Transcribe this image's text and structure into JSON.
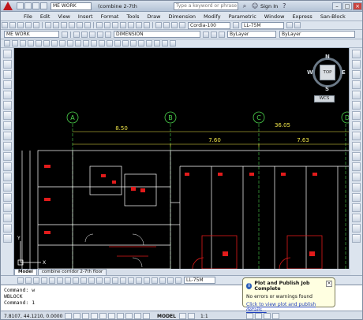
{
  "titlebar": {
    "workspace": "ME WORK",
    "title": "(combine 2-7th",
    "search_placeholder": "Type a keyword or phrase",
    "signin": "Sign In"
  },
  "menu": {
    "items": [
      "File",
      "Edit",
      "View",
      "Insert",
      "Format",
      "Tools",
      "Draw",
      "Dimension",
      "Modify",
      "Parametric",
      "Window",
      "Express",
      "San-Block"
    ]
  },
  "toolbar": {
    "text_style": "Cordia-100",
    "dim_style": "LL-75M",
    "workspace_combo": "ME WORK",
    "dimension_label": "DIMENSION",
    "layer_color": "ByLayer",
    "layer_lineweight": "ByLayer"
  },
  "viewcube": {
    "top": "TOP",
    "n": "N",
    "s": "S",
    "e": "E",
    "w": "W",
    "wcs": "WCS"
  },
  "drawing": {
    "grid_labels": [
      "A",
      "B",
      "C",
      "D"
    ],
    "dims": [
      "8.50",
      "36.05",
      "7.60",
      "7.63"
    ],
    "colors": {
      "background": "#000000",
      "grid_line": "#4cd34c",
      "dimension": "#f2e74a",
      "walls": "#ffffff",
      "red": "#e21b1b"
    }
  },
  "tabs": [
    "Model",
    "combine corridor 2-7th floor"
  ],
  "bottom_toolbar": {
    "dim_style": "LL-75M"
  },
  "command": {
    "lines": [
      "Command: w",
      "WBLOCK",
      "Command: 1"
    ]
  },
  "statusbar": {
    "coords": "7.8107,  44.1210, 0.0000",
    "model": "MODEL",
    "scale": "1:1"
  },
  "notification": {
    "title": "Plot and Publish Job Complete",
    "message": "No errors or warnings found",
    "link": "Click to view plot and publish details..."
  }
}
